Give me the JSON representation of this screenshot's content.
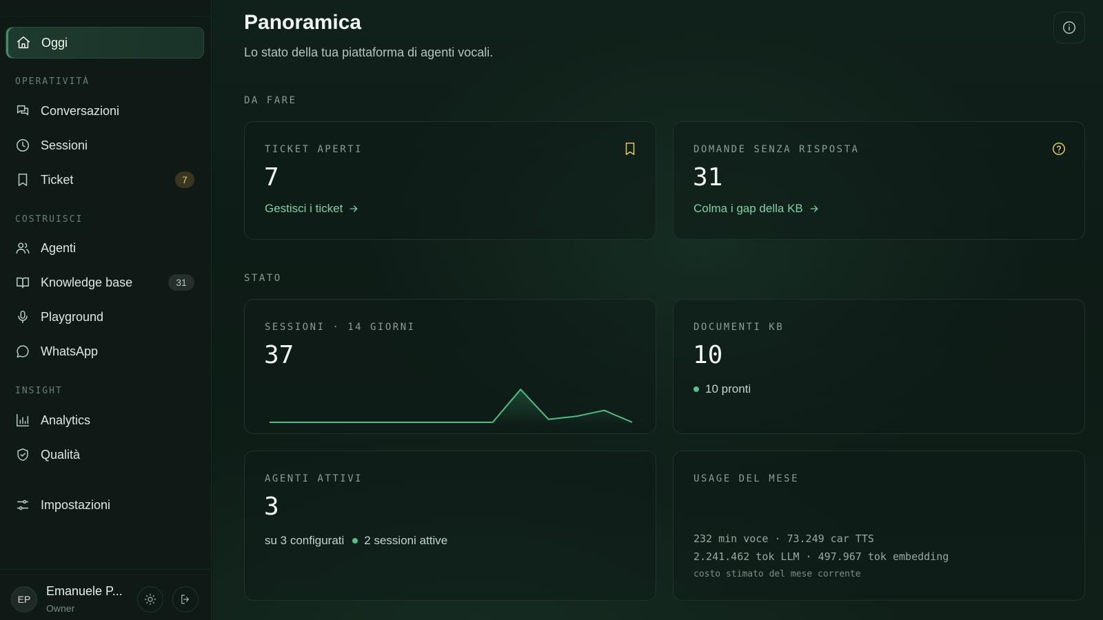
{
  "sidebar": {
    "active_item": {
      "label": "Oggi",
      "icon": "home-icon"
    },
    "sections": [
      {
        "label": "OPERATIVITÀ"
      },
      {
        "label": "COSTRUISCI"
      },
      {
        "label": "INSIGHT"
      }
    ],
    "items": [
      {
        "label": "Conversazioni",
        "icon": "chat-icon"
      },
      {
        "label": "Sessioni",
        "icon": "clock-icon"
      },
      {
        "label": "Ticket",
        "icon": "bookmark-icon",
        "badge": "7"
      },
      {
        "label": "Agenti",
        "icon": "users-icon"
      },
      {
        "label": "Knowledge base",
        "icon": "book-icon",
        "badge": "31"
      },
      {
        "label": "Playground",
        "icon": "mic-icon"
      },
      {
        "label": "WhatsApp",
        "icon": "message-circle-icon"
      },
      {
        "label": "Analytics",
        "icon": "bar-chart-icon"
      },
      {
        "label": "Qualità",
        "icon": "shield-check-icon"
      },
      {
        "label": "Impostazioni",
        "icon": "sliders-icon"
      }
    ],
    "user": {
      "initials": "EP",
      "name": "Emanuele P...",
      "role": "Owner"
    }
  },
  "header": {
    "title": "Panoramica",
    "subtitle": "Lo stato della tua piattaforma di agenti vocali."
  },
  "groups": {
    "todo": "DA FARE",
    "status": "STATO"
  },
  "cards": {
    "tickets": {
      "label": "TICKET APERTI",
      "value": "7",
      "link": "Gestisci i ticket"
    },
    "unanswered": {
      "label": "DOMANDE SENZA RISPOSTA",
      "value": "31",
      "link": "Colma i gap della KB"
    },
    "sessions": {
      "label": "SESSIONI · 14 GIORNI",
      "value": "37"
    },
    "documents": {
      "label": "DOCUMENTI KB",
      "value": "10",
      "status": "10 pronti"
    },
    "agents": {
      "label": "AGENTI ATTIVI",
      "value": "3",
      "configured": "su 3 configurati",
      "active_sessions": "2 sessioni attive"
    },
    "usage": {
      "label": "USAGE DEL MESE",
      "line1": "232 min voce · 73.249 car TTS",
      "line2": "2.241.462 tok LLM · 497.967 tok embedding",
      "note": "costo stimato del mese corrente"
    }
  },
  "colors": {
    "accent": "#7fd0a6",
    "warning": "#e2c364",
    "ok": "#55c08a"
  },
  "chart_data": {
    "type": "line",
    "x": [
      1,
      2,
      3,
      4,
      5,
      6,
      7,
      8,
      9,
      10,
      11,
      12,
      13,
      14
    ],
    "series": [
      {
        "values": [
          0,
          0,
          0,
          0,
          0,
          0,
          0,
          0,
          0,
          11,
          1,
          2,
          4,
          0
        ]
      }
    ],
    "ylim": [
      0,
      12
    ]
  }
}
